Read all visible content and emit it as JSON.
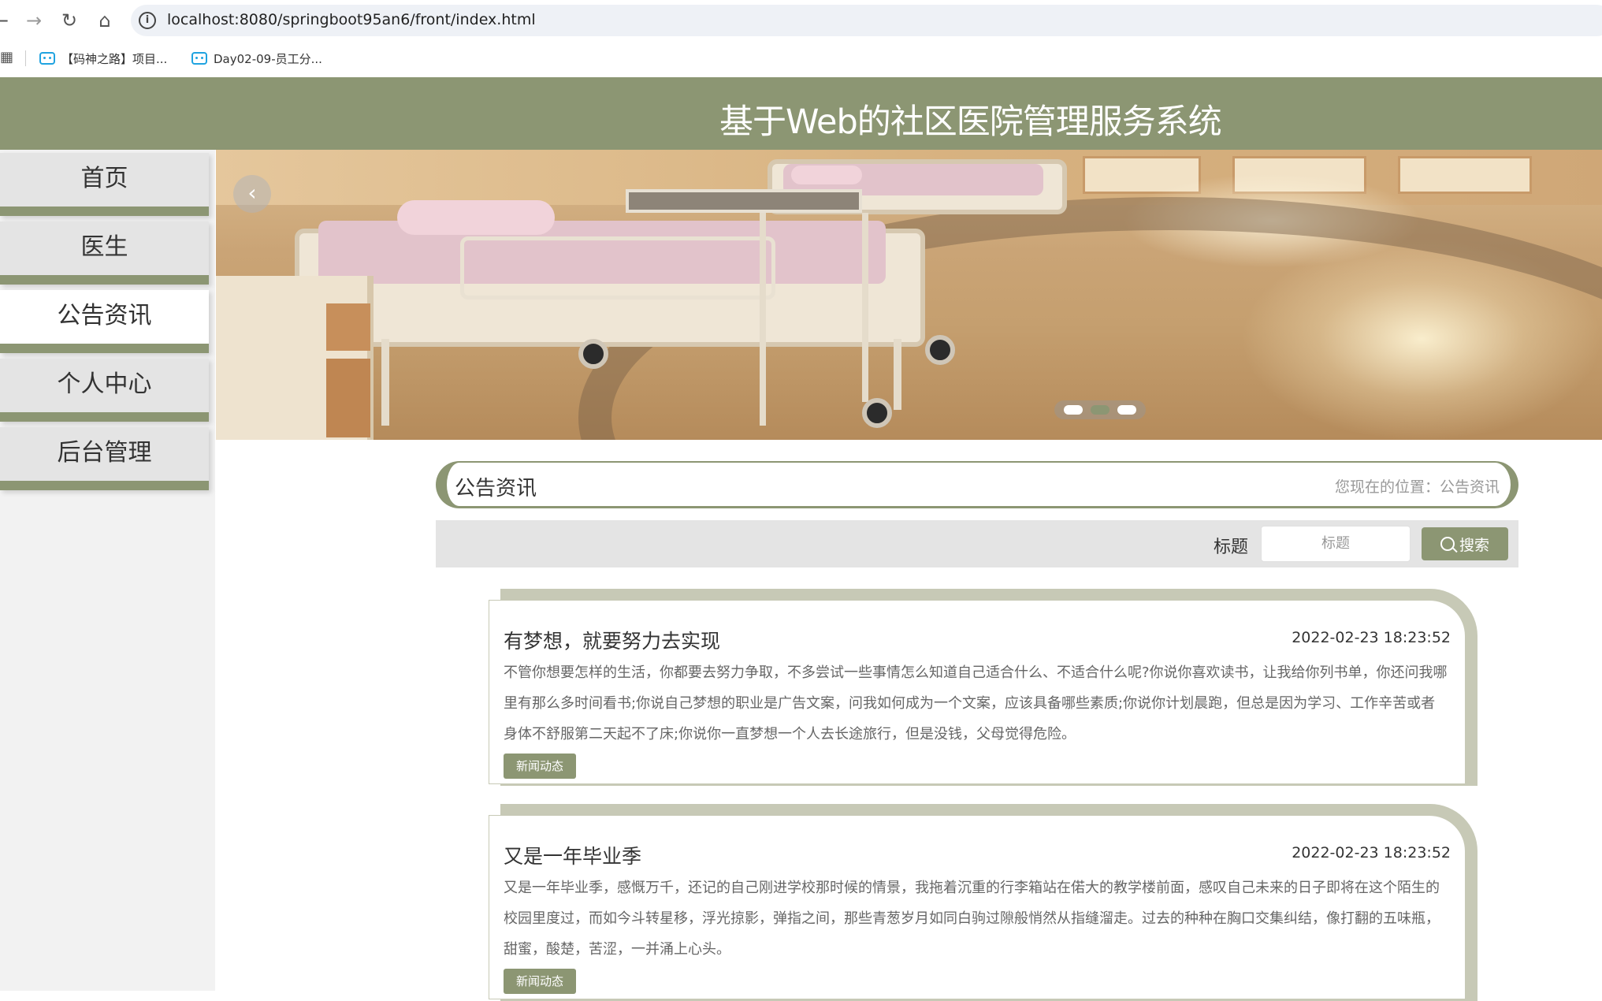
{
  "browser": {
    "url": "localhost:8080/springboot95an6/front/index.html",
    "bookmarks": [
      {
        "label": "【码神之路】项目...",
        "icon": "bilibili-icon"
      },
      {
        "label": "Day02-09-员工分...",
        "icon": "bilibili-icon"
      }
    ]
  },
  "header": {
    "title": "基于Web的社区医院管理服务系统"
  },
  "sidebar": {
    "items": [
      {
        "label": "首页",
        "active": false
      },
      {
        "label": "医生",
        "active": false
      },
      {
        "label": "公告资讯",
        "active": true
      },
      {
        "label": "个人中心",
        "active": false
      },
      {
        "label": "后台管理",
        "active": false
      }
    ]
  },
  "banner": {
    "slide_count": 3,
    "active_slide": 2
  },
  "section": {
    "title": "公告资讯",
    "breadcrumb": "您现在的位置：公告资讯"
  },
  "search": {
    "label": "标题",
    "placeholder": "标题",
    "button_label": "搜索"
  },
  "news": [
    {
      "title": "有梦想，就要努力去实现",
      "date": "2022-02-23 18:23:52",
      "body": "不管你想要怎样的生活，你都要去努力争取，不多尝试一些事情怎么知道自己适合什么、不适合什么呢?你说你喜欢读书，让我给你列书单，你还问我哪里有那么多时间看书;你说自己梦想的职业是广告文案，问我如何成为一个文案，应该具备哪些素质;你说你计划晨跑，但总是因为学习、工作辛苦或者身体不舒服第二天起不了床;你说你一直梦想一个人去长途旅行，但是没钱，父母觉得危险。",
      "tag": "新闻动态"
    },
    {
      "title": "又是一年毕业季",
      "date": "2022-02-23 18:23:52",
      "body": "又是一年毕业季，感慨万千，还记的自己刚进学校那时候的情景，我拖着沉重的行李箱站在偌大的教学楼前面，感叹自己未来的日子即将在这个陌生的校园里度过，而如今斗转星移，浮光掠影，弹指之间，那些青葱岁月如同白驹过隙般悄然从指缝溜走。过去的种种在胸口交集纠结，像打翻的五味瓶，甜蜜，酸楚，苦涩，一并涌上心头。",
      "tag": "新闻动态"
    }
  ],
  "colors": {
    "accent": "#8c9673",
    "sidebar_bg": "#e4e4e4",
    "card_shadow": "#c7c9b6"
  }
}
